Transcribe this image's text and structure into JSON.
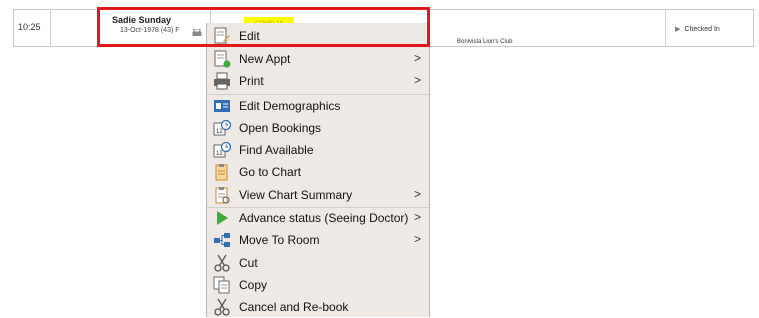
{
  "row": {
    "time": "10:25",
    "patient_name": "Sadie Sunday",
    "patient_dob": "13-Oct-1978 (43) F",
    "badge": "COVID-19",
    "club": "Bonivista Lion's Club",
    "status": "Checked In"
  },
  "menu": {
    "items": [
      {
        "label": "Edit",
        "icon": "edit-icon",
        "submenu": false
      },
      {
        "label": "New Appt",
        "icon": "new-appt-icon",
        "submenu": true
      },
      {
        "label": "Print",
        "icon": "printer-icon",
        "submenu": true
      },
      {
        "label": "Edit Demographics",
        "icon": "demographics-icon",
        "submenu": false
      },
      {
        "label": "Open Bookings",
        "icon": "calendar-clock-icon",
        "submenu": false
      },
      {
        "label": "Find Available",
        "icon": "calendar-clock-icon",
        "submenu": false
      },
      {
        "label": "Go to Chart",
        "icon": "chart-icon",
        "submenu": false
      },
      {
        "label": "View Chart Summary",
        "icon": "chart-summary-icon",
        "submenu": true
      },
      {
        "label": "Advance status (Seeing Doctor)",
        "icon": "play-icon",
        "submenu": true
      },
      {
        "label": "Move To Room",
        "icon": "room-icon",
        "submenu": true
      },
      {
        "label": "Cut",
        "icon": "scissors-icon",
        "submenu": false
      },
      {
        "label": "Copy",
        "icon": "copy-icon",
        "submenu": false
      },
      {
        "label": "Cancel and Re-book",
        "icon": "scissors-icon",
        "submenu": false
      }
    ],
    "submenu_glyph": ">"
  },
  "colors": {
    "highlight": "#e11919",
    "menu_bg": "#efe9e5",
    "badge": "#ffff00",
    "accent_blue": "#2f6fb6",
    "accent_green": "#3caa3c"
  }
}
